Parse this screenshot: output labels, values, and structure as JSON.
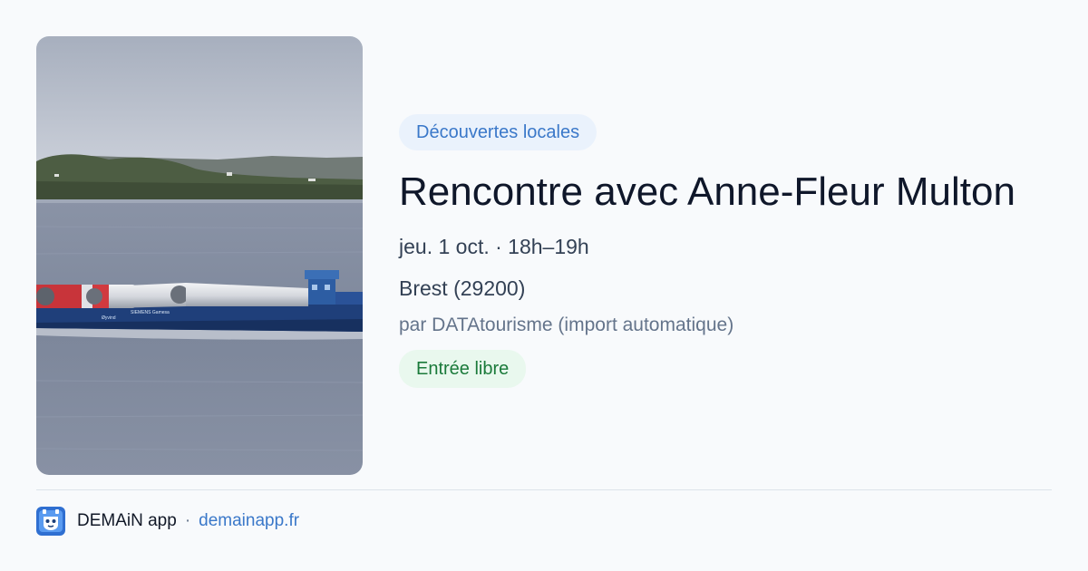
{
  "event": {
    "image_alt": "Navire transportant des pales d'éoliennes en rade de Brest",
    "ship_markings": {
      "left": "Øyvind",
      "right": "SIEMENS Gamesa"
    },
    "category": "Découvertes locales",
    "title": "Rencontre avec Anne-Fleur Multon",
    "datetime": "jeu. 1 oct. · 18h–19h",
    "location": "Brest (29200)",
    "organizer": "par DATAtourisme (import automatique)",
    "price": "Entrée libre"
  },
  "footer": {
    "app_name": "DEMAiN app",
    "separator": "·",
    "site": "demainapp.fr"
  },
  "icons": {
    "logo": "demain-app-logo-icon"
  },
  "colors": {
    "background": "#f8fafc",
    "accent": "#3a78c9",
    "category_badge_bg": "#eaf2fc",
    "price_badge_bg": "#e9f8ee",
    "price_badge_text": "#1a7a3a",
    "title": "#0f172a"
  }
}
